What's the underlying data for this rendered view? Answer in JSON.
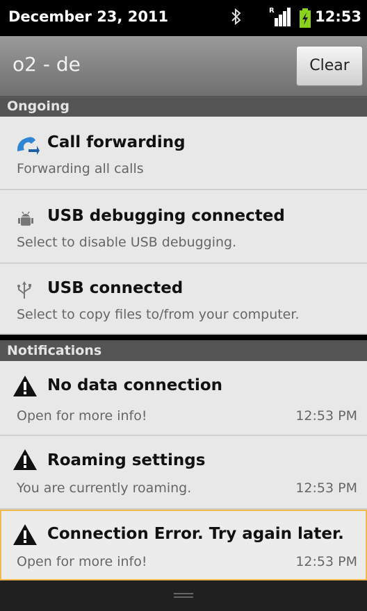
{
  "status_bar": {
    "date": "December 23, 2011",
    "time": "12:53",
    "icons": [
      "bluetooth-icon",
      "signal-icon",
      "battery-charging-icon"
    ],
    "signal_badge": "R"
  },
  "header": {
    "carrier": "o2 - de",
    "clear_label": "Clear"
  },
  "ongoing": {
    "label": "Ongoing",
    "items": [
      {
        "icon": "call-forwarding-icon",
        "title": "Call forwarding",
        "subtitle": "Forwarding all calls"
      },
      {
        "icon": "android-debug-icon",
        "title": "USB debugging connected",
        "subtitle": "Select to disable USB debugging."
      },
      {
        "icon": "usb-icon",
        "title": "USB connected",
        "subtitle": "Select to copy files to/from your computer."
      }
    ]
  },
  "notifications": {
    "label": "Notifications",
    "items": [
      {
        "icon": "warning-icon",
        "title": "No data connection",
        "subtitle": "Open for more info!",
        "time": "12:53 PM"
      },
      {
        "icon": "warning-icon",
        "title": "Roaming settings",
        "subtitle": "You are currently roaming.",
        "time": "12:53 PM"
      },
      {
        "icon": "warning-icon",
        "title": "Connection Error. Try again later.",
        "subtitle": "Open for more info!",
        "time": "12:53 PM"
      }
    ]
  },
  "colors": {
    "accent_highlight": "#f2b84b",
    "battery": "#8ad11c",
    "call_icon": "#2f86d4"
  }
}
